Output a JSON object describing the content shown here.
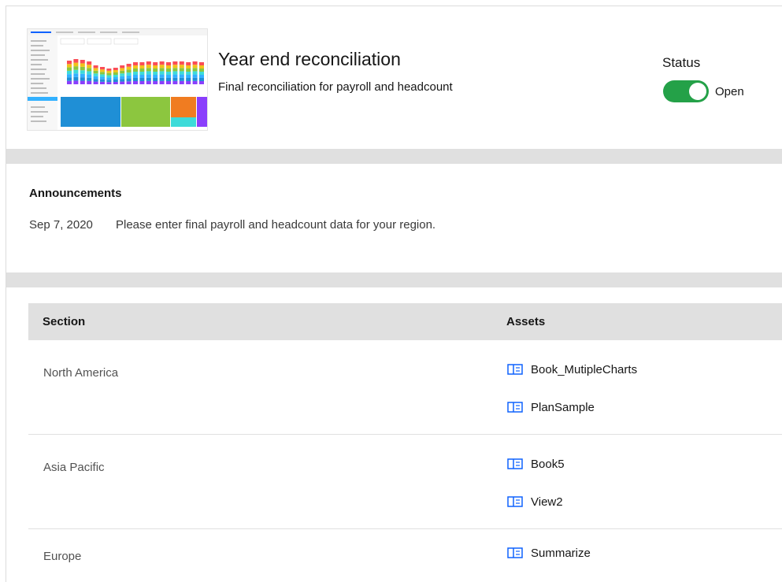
{
  "header": {
    "title": "Year end reconciliation",
    "description": "Final reconciliation for payroll and headcount",
    "status_label": "Status",
    "status_value": "Open",
    "status_on": true,
    "thumbnail_icon": "dashboard-thumbnail"
  },
  "announcements": {
    "heading": "Announcements",
    "items": [
      {
        "date": "Sep 7, 2020",
        "text": "Please enter final payroll and headcount data for your region."
      }
    ]
  },
  "table": {
    "columns": [
      "Section",
      "Assets"
    ],
    "rows": [
      {
        "section": "North America",
        "assets": [
          "Book_MutipleCharts",
          "PlanSample"
        ]
      },
      {
        "section": "Asia Pacific",
        "assets": [
          "Book5",
          "View2"
        ]
      },
      {
        "section": "Europe",
        "assets": [
          "Summarize"
        ]
      }
    ],
    "asset_icon": "book-icon"
  },
  "colors": {
    "accent": "#0f62fe",
    "toggle_on": "#24a148",
    "band": "#e0e0e0"
  }
}
